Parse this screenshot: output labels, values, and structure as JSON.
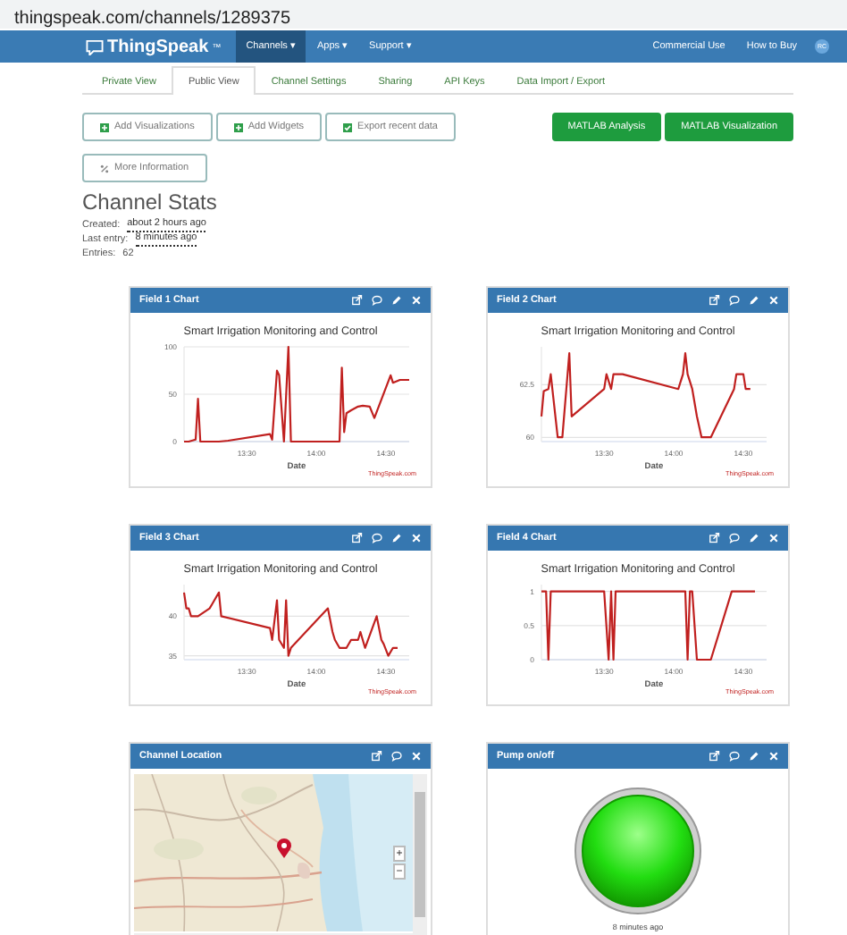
{
  "browser": {
    "url": "thingspeak.com/channels/1289375"
  },
  "navbar": {
    "brand": "ThingSpeak",
    "trademark": "™",
    "menus": [
      {
        "label": "Channels ▾",
        "selected": true
      },
      {
        "label": "Apps ▾",
        "selected": false
      },
      {
        "label": "Support ▾",
        "selected": false
      }
    ],
    "links": [
      "Commercial Use",
      "How to Buy"
    ],
    "avatar": "RC"
  },
  "tabs": [
    {
      "label": "Private View",
      "selected": false
    },
    {
      "label": "Public View",
      "selected": true
    },
    {
      "label": "Channel Settings",
      "selected": false
    },
    {
      "label": "Sharing",
      "selected": false
    },
    {
      "label": "API Keys",
      "selected": false
    },
    {
      "label": "Data Import / Export",
      "selected": false
    }
  ],
  "actions": [
    {
      "label": "Add Visualizations",
      "kind": "add"
    },
    {
      "label": "Add Widgets",
      "kind": "add"
    },
    {
      "label": "Export recent data",
      "kind": "export"
    },
    {
      "label": "More Information",
      "kind": "info"
    }
  ],
  "matlab_buttons": [
    "MATLAB Analysis",
    "MATLAB Visualization"
  ],
  "stats": {
    "title": "Channel Stats",
    "items": [
      {
        "label": "Created:",
        "value": "about 2 hours ago",
        "kind": "link"
      },
      {
        "label": "Last entry:",
        "value": "8 minutes ago",
        "kind": "link"
      },
      {
        "label": "Entries:",
        "value": "62",
        "kind": "plain"
      }
    ]
  },
  "cards": [
    {
      "kind": "chart",
      "title": "Field 1 Chart",
      "editable": true,
      "credit": "ThingSpeak.com",
      "chart_data": {
        "type": "line",
        "title": "Smart Irrigation Monitoring and Control",
        "xlabel": "Date",
        "xlim": [
          13.05,
          14.667
        ],
        "ylim": [
          0,
          100
        ],
        "xticks": [
          {
            "value": 13.5,
            "label": "13:30"
          },
          {
            "value": 14,
            "label": "14:00"
          },
          {
            "value": 14.5,
            "label": "14:30"
          }
        ],
        "yticks": [
          0,
          50,
          100
        ],
        "x": [
          13.05,
          13.083,
          13.133,
          13.15,
          13.167,
          13.25,
          13.3,
          13.367,
          13.667,
          13.683,
          13.717,
          13.733,
          13.767,
          13.8,
          13.817,
          13.883,
          14.167,
          14.183,
          14.2,
          14.217,
          14.25,
          14.3,
          14.333,
          14.383,
          14.417,
          14.533,
          14.55,
          14.6,
          14.667
        ],
        "series": [
          {
            "color": "#c0201f",
            "values": [
              0,
              0,
              2,
              45,
              0,
              0,
              0,
              1,
              8,
              2,
              75,
              70,
              0,
              100,
              0,
              0,
              0,
              78,
              10,
              30,
              33,
              37,
              38,
              37,
              25,
              70,
              62,
              65,
              65
            ]
          }
        ]
      }
    },
    {
      "kind": "chart",
      "title": "Field 2 Chart",
      "editable": true,
      "credit": "ThingSpeak.com",
      "chart_data": {
        "type": "line",
        "title": "Smart Irrigation Monitoring and Control",
        "xlabel": "Date",
        "xlim": [
          13.05,
          14.667
        ],
        "ylim": [
          59.8,
          64.3
        ],
        "xticks": [
          {
            "value": 13.5,
            "label": "13:30"
          },
          {
            "value": 14,
            "label": "14:00"
          },
          {
            "value": 14.5,
            "label": "14:30"
          }
        ],
        "yticks": [
          60,
          62.5
        ],
        "x": [
          13.05,
          13.067,
          13.1,
          13.117,
          13.167,
          13.2,
          13.25,
          13.267,
          13.5,
          13.517,
          13.55,
          13.567,
          13.633,
          14.033,
          14.067,
          14.083,
          14.1,
          14.133,
          14.167,
          14.2,
          14.267,
          14.433,
          14.45,
          14.5,
          14.517,
          14.55
        ],
        "series": [
          {
            "color": "#c0201f",
            "values": [
              61,
              62.2,
              62.3,
              63,
              60,
              60,
              64,
              61,
              62.3,
              63,
              62.3,
              63,
              63,
              62.3,
              63,
              64,
              63,
              62.3,
              61,
              60,
              60,
              62.3,
              63,
              63,
              62.3,
              62.3
            ]
          }
        ]
      }
    },
    {
      "kind": "chart",
      "title": "Field 3 Chart",
      "editable": true,
      "credit": "ThingSpeak.com",
      "chart_data": {
        "type": "line",
        "title": "Smart Irrigation Monitoring and Control",
        "xlabel": "Date",
        "xlim": [
          13.05,
          14.667
        ],
        "ylim": [
          34.5,
          44
        ],
        "xticks": [
          {
            "value": 13.5,
            "label": "13:30"
          },
          {
            "value": 14,
            "label": "14:00"
          },
          {
            "value": 14.5,
            "label": "14:30"
          }
        ],
        "yticks": [
          35,
          40
        ],
        "x": [
          13.05,
          13.067,
          13.083,
          13.1,
          13.15,
          13.233,
          13.25,
          13.3,
          13.317,
          13.667,
          13.683,
          13.717,
          13.733,
          13.767,
          13.783,
          13.8,
          13.817,
          14.083,
          14.117,
          14.133,
          14.167,
          14.217,
          14.25,
          14.3,
          14.317,
          14.35,
          14.433,
          14.467,
          14.483,
          14.517,
          14.55,
          14.583
        ],
        "series": [
          {
            "color": "#c0201f",
            "values": [
              43,
              41,
              41,
              40,
              40,
              41,
              41.5,
              43,
              40,
              38.5,
              37,
              42,
              37,
              36,
              42,
              35,
              36,
              41,
              38,
              37,
              36,
              36,
              37,
              37,
              38,
              36,
              40,
              37,
              36.5,
              35,
              36,
              36
            ]
          }
        ]
      }
    },
    {
      "kind": "chart",
      "title": "Field 4 Chart",
      "editable": true,
      "credit": "ThingSpeak.com",
      "chart_data": {
        "type": "line",
        "title": "Smart Irrigation Monitoring and Control",
        "xlabel": "Date",
        "xlim": [
          13.05,
          14.667
        ],
        "ylim": [
          0,
          1.1
        ],
        "xticks": [
          {
            "value": 13.5,
            "label": "13:30"
          },
          {
            "value": 14,
            "label": "14:00"
          },
          {
            "value": 14.5,
            "label": "14:30"
          }
        ],
        "yticks": [
          0,
          0.5,
          1
        ],
        "x": [
          13.05,
          13.083,
          13.1,
          13.117,
          13.25,
          13.5,
          13.533,
          13.55,
          13.567,
          13.583,
          14.083,
          14.1,
          14.117,
          14.133,
          14.167,
          14.267,
          14.417,
          14.583
        ],
        "series": [
          {
            "color": "#c0201f",
            "values": [
              1,
              1,
              0,
              1,
              1,
              1,
              0,
              1,
              0,
              1,
              1,
              0,
              1,
              1,
              0,
              0,
              1,
              1
            ]
          }
        ]
      }
    },
    {
      "kind": "map",
      "title": "Channel Location",
      "editable": false,
      "zoom_in": "+",
      "zoom_out": "−"
    },
    {
      "kind": "lamp",
      "title": "Pump on/off",
      "editable": true,
      "on": true,
      "time": "8 minutes ago"
    }
  ]
}
